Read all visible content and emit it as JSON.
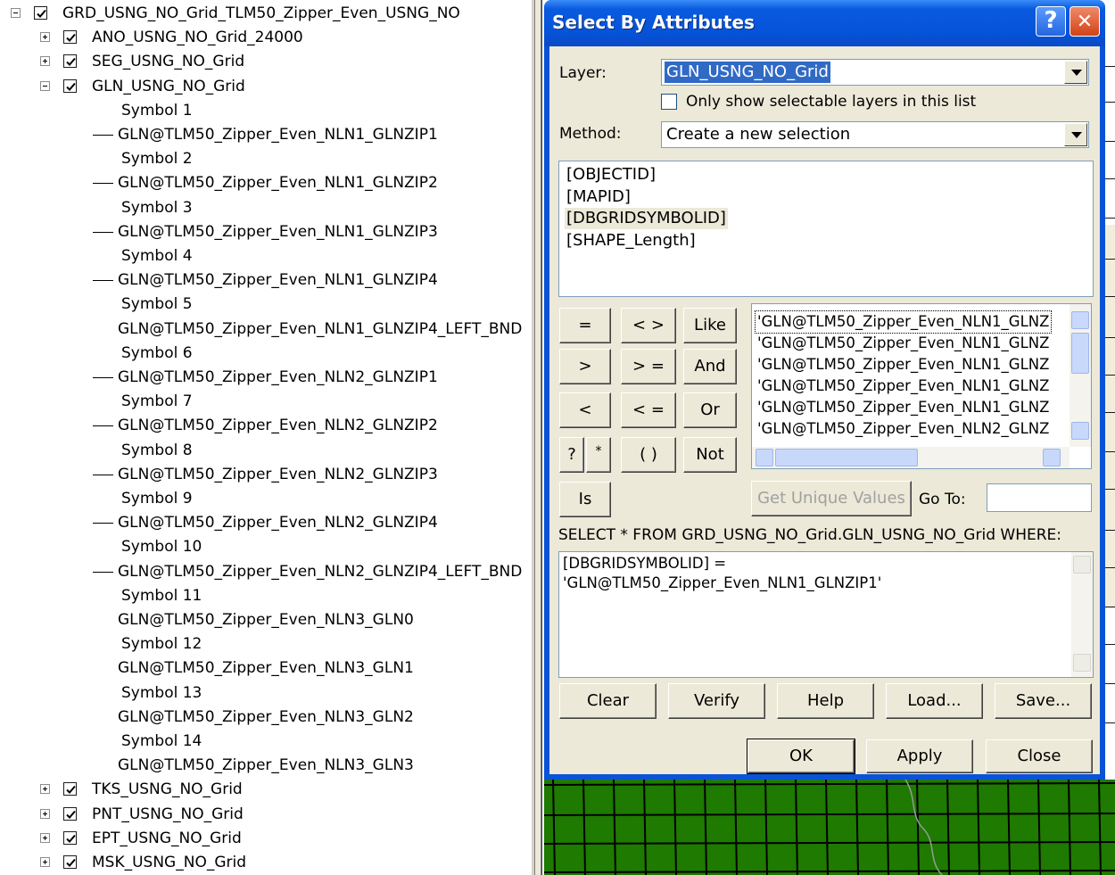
{
  "toc": {
    "rows": [
      {
        "label": "GRD_USNG_NO_Grid_TLM50_Zipper_Even_USNG_NO",
        "expander": "minus",
        "checked": true,
        "level": 0
      },
      {
        "label": "ANO_USNG_NO_Grid_24000",
        "expander": "plus",
        "checked": true,
        "level": 1
      },
      {
        "label": "SEG_USNG_NO_Grid",
        "expander": "plus",
        "checked": true,
        "level": 1
      },
      {
        "label": "GLN_USNG_NO_Grid",
        "expander": "minus",
        "checked": true,
        "level": 1
      },
      {
        "label": "Symbol 1",
        "level": 2
      },
      {
        "label": "GLN@TLM50_Zipper_Even_NLN1_GLNZIP1",
        "level": 3,
        "dash": true
      },
      {
        "label": "Symbol 2",
        "level": 2
      },
      {
        "label": "GLN@TLM50_Zipper_Even_NLN1_GLNZIP2",
        "level": 3,
        "dash": true
      },
      {
        "label": "Symbol 3",
        "level": 2
      },
      {
        "label": "GLN@TLM50_Zipper_Even_NLN1_GLNZIP3",
        "level": 3,
        "dash": true
      },
      {
        "label": "Symbol 4",
        "level": 2
      },
      {
        "label": "GLN@TLM50_Zipper_Even_NLN1_GLNZIP4",
        "level": 3,
        "dash": true
      },
      {
        "label": "Symbol 5",
        "level": 2
      },
      {
        "label": "GLN@TLM50_Zipper_Even_NLN1_GLNZIP4_LEFT_BND",
        "level": 3,
        "dash": false
      },
      {
        "label": "Symbol 6",
        "level": 2
      },
      {
        "label": "GLN@TLM50_Zipper_Even_NLN2_GLNZIP1",
        "level": 3,
        "dash": true
      },
      {
        "label": "Symbol 7",
        "level": 2
      },
      {
        "label": "GLN@TLM50_Zipper_Even_NLN2_GLNZIP2",
        "level": 3,
        "dash": true
      },
      {
        "label": "Symbol 8",
        "level": 2
      },
      {
        "label": "GLN@TLM50_Zipper_Even_NLN2_GLNZIP3",
        "level": 3,
        "dash": true
      },
      {
        "label": "Symbol 9",
        "level": 2
      },
      {
        "label": "GLN@TLM50_Zipper_Even_NLN2_GLNZIP4",
        "level": 3,
        "dash": true
      },
      {
        "label": "Symbol 10",
        "level": 2
      },
      {
        "label": "GLN@TLM50_Zipper_Even_NLN2_GLNZIP4_LEFT_BND",
        "level": 3,
        "dash": true
      },
      {
        "label": "Symbol 11",
        "level": 2
      },
      {
        "label": "GLN@TLM50_Zipper_Even_NLN3_GLN0",
        "level": 3,
        "dash": false
      },
      {
        "label": "Symbol 12",
        "level": 2
      },
      {
        "label": "GLN@TLM50_Zipper_Even_NLN3_GLN1",
        "level": 3,
        "dash": false
      },
      {
        "label": "Symbol 13",
        "level": 2
      },
      {
        "label": "GLN@TLM50_Zipper_Even_NLN3_GLN2",
        "level": 3,
        "dash": false
      },
      {
        "label": "Symbol 14",
        "level": 2
      },
      {
        "label": "GLN@TLM50_Zipper_Even_NLN3_GLN3",
        "level": 3,
        "dash": false
      },
      {
        "label": "TKS_USNG_NO_Grid",
        "expander": "plus",
        "checked": true,
        "level": 1
      },
      {
        "label": "PNT_USNG_NO_Grid",
        "expander": "plus",
        "checked": true,
        "level": 1
      },
      {
        "label": "EPT_USNG_NO_Grid",
        "expander": "plus",
        "checked": true,
        "level": 1
      },
      {
        "label": "MSK_USNG_NO_Grid",
        "expander": "plus",
        "checked": true,
        "level": 1
      }
    ]
  },
  "dialog": {
    "title": "Select By Attributes",
    "help_glyph": "?",
    "close_glyph": "✕",
    "layer_label": "Layer:",
    "layer_value": "GLN_USNG_NO_Grid",
    "selectable_only_label": "Only show selectable layers in this list",
    "selectable_only_checked": false,
    "method_label": "Method:",
    "method_value": "Create a new selection",
    "fields": [
      "[OBJECTID]",
      "[MAPID]",
      "[DBGRIDSYMBOLID]",
      "[SHAPE_Length]"
    ],
    "selected_field": "[DBGRIDSYMBOLID]",
    "operators": {
      "eq": "=",
      "ne": "< >",
      "like": "Like",
      "gt": ">",
      "ge": "> =",
      "and": "And",
      "lt": "<",
      "le": "< =",
      "or": "Or",
      "q": "?",
      "star": "*",
      "paren": "( )",
      "not": "Not",
      "is": "Is"
    },
    "unique_values": [
      "'GLN@TLM50_Zipper_Even_NLN1_GLNZ",
      "'GLN@TLM50_Zipper_Even_NLN1_GLNZ",
      "'GLN@TLM50_Zipper_Even_NLN1_GLNZ",
      "'GLN@TLM50_Zipper_Even_NLN1_GLNZ",
      "'GLN@TLM50_Zipper_Even_NLN1_GLNZ",
      "'GLN@TLM50_Zipper_Even_NLN2_GLNZ"
    ],
    "get_unique_label": "Get Unique Values",
    "goto_label": "Go To:",
    "goto_value": "",
    "sql_label": "SELECT * FROM GRD_USNG_NO_Grid.GLN_USNG_NO_Grid WHERE:",
    "sql_line1": "[DBGRIDSYMBOLID] =",
    "sql_line2": "'GLN@TLM50_Zipper_Even_NLN1_GLNZIP1'",
    "clear_label": "Clear",
    "verify_label": "Verify",
    "help_label": "Help",
    "load_label": "Load...",
    "save_label": "Save...",
    "ok_label": "OK",
    "apply_label": "Apply",
    "close_label": "Close"
  },
  "colors": {
    "title_blue": "#0553d8",
    "dialog_face": "#ece9d8",
    "map_green": "#1e7a00"
  }
}
